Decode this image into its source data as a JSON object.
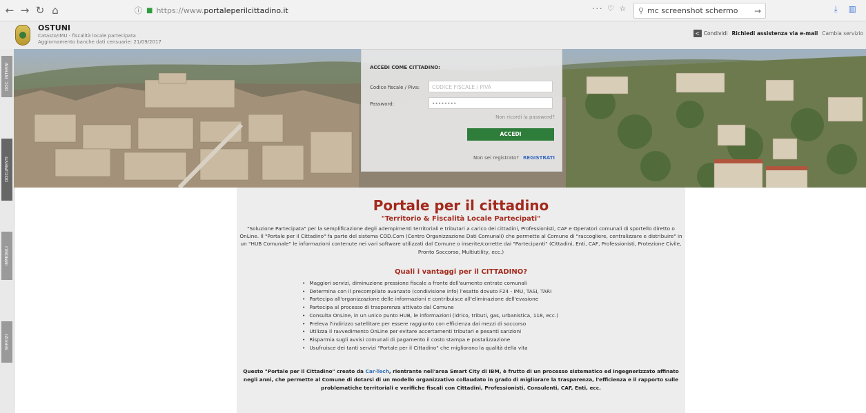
{
  "browser": {
    "url_proto": "https://www.",
    "url_host": "portaleperilcittadino.it",
    "search_value": "mc screenshot schermo"
  },
  "header": {
    "town": "OSTUNI",
    "subtitle": "Catasto/IMU - fiscalità locale partecipata",
    "update_line": "Aggiornamento banche dati censuarie: 21/09/2017",
    "share_label": "Condividi",
    "support_label": "Richiedi assistenza via e-mail",
    "service_label": "Cambia servizio"
  },
  "side_tabs": [
    "DOC. INTERNI",
    "DOCUMENTI",
    "IMMOBILI",
    "SERVIZI"
  ],
  "login": {
    "title": "ACCEDI COME CITTADINO:",
    "cf_label": "Codice fiscale / Piva:",
    "cf_placeholder": "CODICE FISCALE / PIVA",
    "pwd_label": "Password:",
    "pwd_value": "••••••••",
    "forgot": "Non ricordi la password?",
    "button": "ACCEDI",
    "not_registered": "Non sei registrato?",
    "register": "REGISTRATI"
  },
  "content": {
    "title": "Portale per il cittadino",
    "subtitle": "\"Territorio & Fiscalità Locale Partecipati\"",
    "intro": "\"Soluzione Partecipata\" per la semplificazione degli adempimenti territoriali e tributari a carico dei cittadini, Professionisti, CAF e Operatori comunali di sportello diretto o OnLine. Il \"Portale per il Cittadino\" fa parte del sistema COD.Com (Centro Organizzazione Dati Comunali) che permette al Comune di \"raccogliere, centralizzare e distribuire\" in un \"HUB Comunale\" le informazioni contenute nei vari software utilizzati dal Comune o inserite/corrette dai \"Partecipanti\" (Cittadini, Enti, CAF, Professionisti, Protezione Civile, Pronto Soccorso, Multiutility, ecc.)",
    "benefits_title": "Quali i vantaggi per il CITTADINO?",
    "benefits": [
      "Maggiori servizi, diminuzione pressione fiscale a fronte dell'aumento entrate comunali",
      "Determina con il precompilato avanzato (condivisione info) l'esatto dovuto F24 - IMU, TASI, TARI",
      "Partecipa all'organizzazione delle informazioni e contribuisce all'eliminazione dell'evasione",
      "Partecipa al processo di trasparenza attivato dal Comune",
      "Consulta OnLine, in un unico punto HUB, le informazioni (idrico, tributi, gas, urbanistica, 118, ecc.)",
      "Preleva l'indirizzo satellitare per essere raggiunto con efficienza dai mezzi di soccorso",
      "Utilizza il ravvedimento OnLine per evitare accertamenti tributari e pesanti sanzioni",
      "Risparmia sugli avvisi comunali di pagamento il costo stampa e postalizzazione",
      "Usufruisce dei tanti servizi \"Portale per il Cittadino\" che migliorano la qualità della vita"
    ],
    "outro_pre": "Questo \"Portale per il Cittadino\" creato da ",
    "outro_brand": "Car-Tech",
    "outro_post": ", rientrante nell'area Smart City di IBM, è frutto di un processo sistematico ed ingegnerizzato affinato negli anni, che permette al Comune di dotarsi di un modello organizzativo collaudato in grado di migliorare la trasparenza, l'efficienza e il rapporto sulle problematiche territoriali e verifiche fiscali con Cittadini, Professionisti, Consulenti, CAF, Enti, ecc."
  },
  "colors": {
    "accent_red": "#a32a1d",
    "login_green": "#2e7d3a",
    "link_blue": "#3a6bc4"
  }
}
